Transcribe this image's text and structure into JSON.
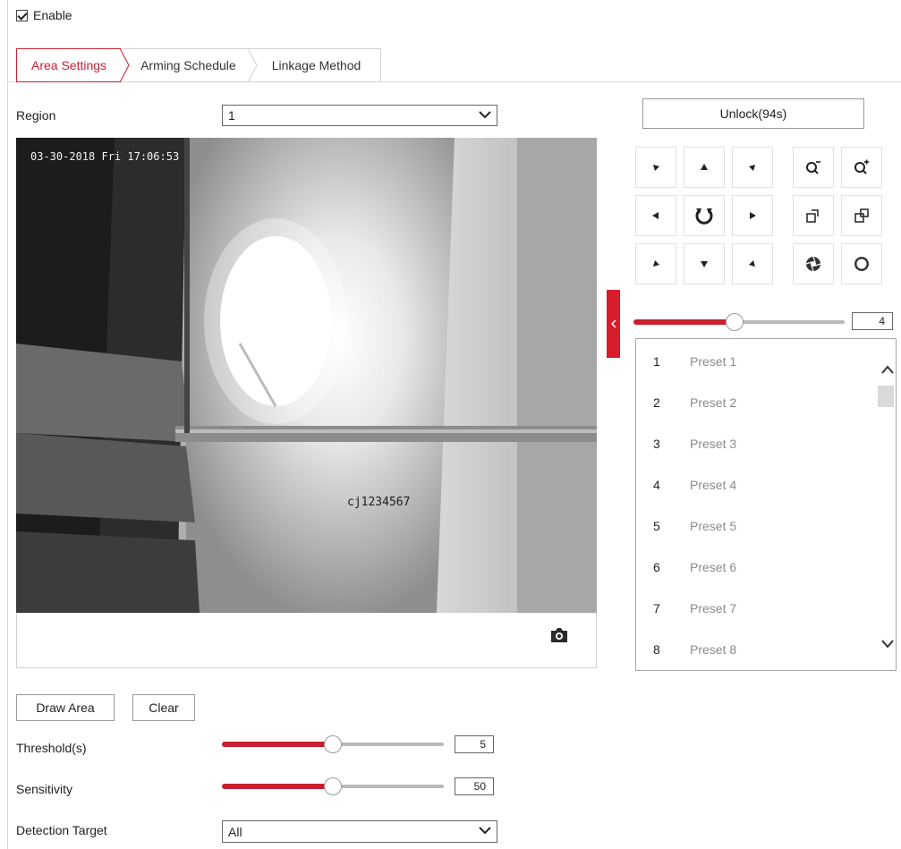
{
  "enable": {
    "label": "Enable",
    "checked": true
  },
  "tabs": [
    {
      "label": "Area Settings",
      "active": true
    },
    {
      "label": "Arming Schedule",
      "active": false
    },
    {
      "label": "Linkage Method",
      "active": false
    }
  ],
  "region": {
    "label": "Region",
    "value": "1"
  },
  "video": {
    "osd_time": "03-30-2018 Fri 17:06:53",
    "osd_name": "cj1234567",
    "snapshot_icon": "camera-icon"
  },
  "actions": {
    "draw_area": "Draw Area",
    "clear": "Clear"
  },
  "threshold": {
    "label": "Threshold(s)",
    "value": "5",
    "level": 0.5
  },
  "sensitivity": {
    "label": "Sensitivity",
    "value": "50",
    "level": 0.5
  },
  "detection_target": {
    "label": "Detection Target",
    "value": "All"
  },
  "ptz": {
    "unlock_label": "Unlock(94s)",
    "speed": {
      "value": "4",
      "level": 0.48
    },
    "presets": [
      {
        "num": "1",
        "name": "Preset 1"
      },
      {
        "num": "2",
        "name": "Preset 2"
      },
      {
        "num": "3",
        "name": "Preset 3"
      },
      {
        "num": "4",
        "name": "Preset 4"
      },
      {
        "num": "5",
        "name": "Preset 5"
      },
      {
        "num": "6",
        "name": "Preset 6"
      },
      {
        "num": "7",
        "name": "Preset 7"
      },
      {
        "num": "8",
        "name": "Preset 8"
      }
    ]
  },
  "colors": {
    "accent": "#c8202f",
    "collapse_tab": "#d71c2b"
  }
}
